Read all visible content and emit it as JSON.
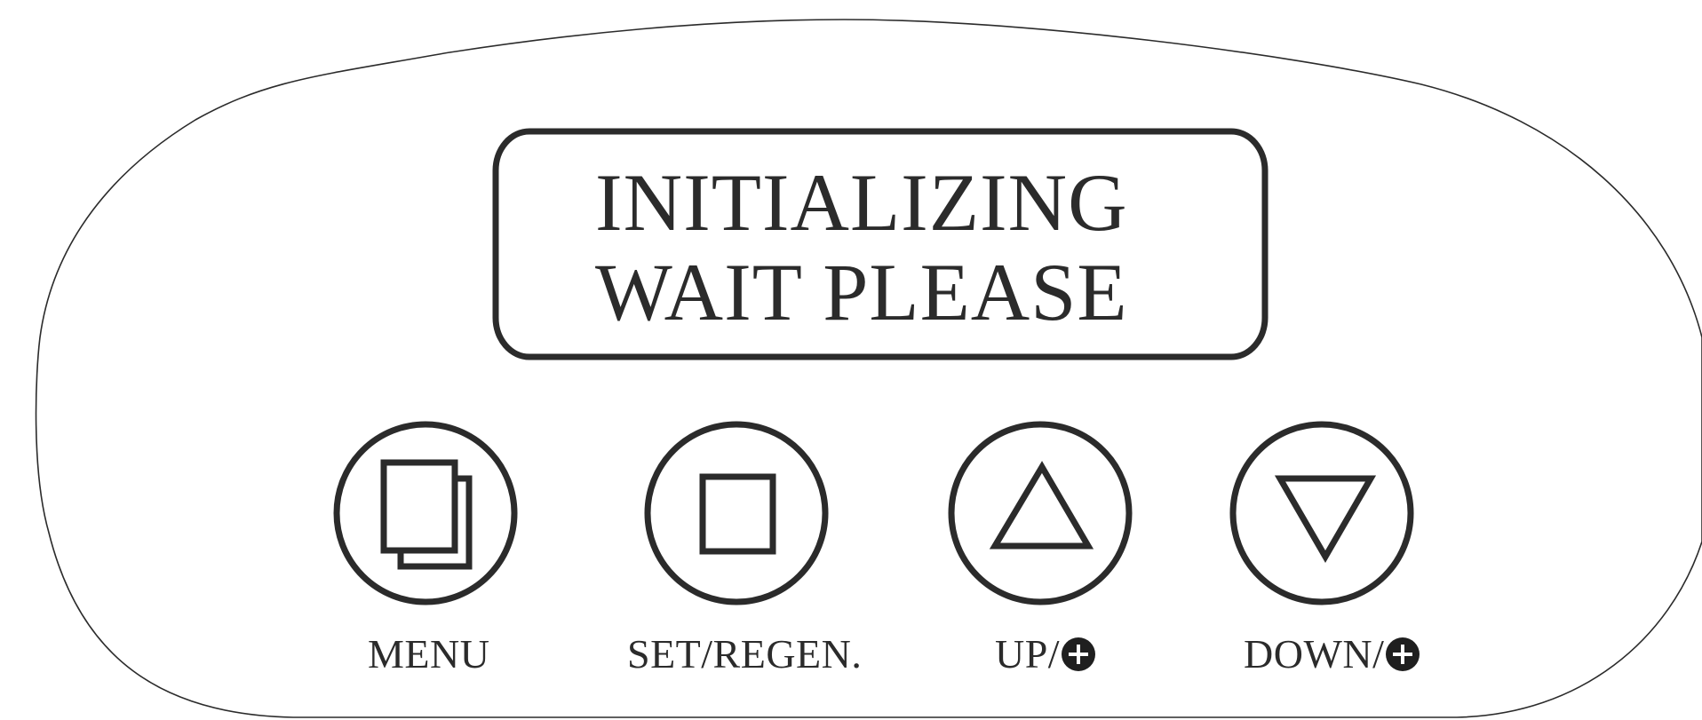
{
  "display": {
    "line1": "INITIALIZING",
    "line2": "WAIT PLEASE"
  },
  "buttons": [
    {
      "id": "menu",
      "label": "MENU",
      "icon": "menu-icon",
      "plus": false
    },
    {
      "id": "set-regen",
      "label": "SET/REGEN.",
      "icon": "square-icon",
      "plus": false
    },
    {
      "id": "up",
      "label": "UP/",
      "icon": "triangle-up-icon",
      "plus": true
    },
    {
      "id": "down",
      "label": "DOWN/",
      "icon": "triangle-down-icon",
      "plus": true
    }
  ],
  "colors": {
    "stroke": "#2b2b2b",
    "background": "#ffffff"
  }
}
